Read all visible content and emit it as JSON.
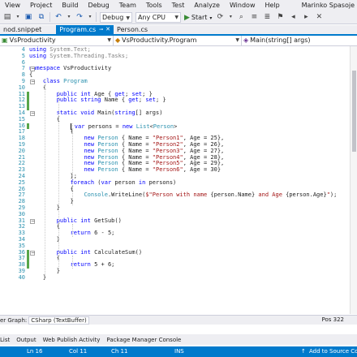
{
  "menubar": {
    "items": [
      "View",
      "Project",
      "Build",
      "Debug",
      "Team",
      "Tools",
      "Test",
      "Analyze",
      "Window",
      "Help"
    ],
    "user": "Marinko Spasoje"
  },
  "toolbar": {
    "configuration": "Debug",
    "platform": "Any CPU",
    "start_label": "Start"
  },
  "tabs": [
    {
      "label": "nod.snippet",
      "active": false
    },
    {
      "label": "Program.cs",
      "active": true
    },
    {
      "label": "Person.cs",
      "active": false
    }
  ],
  "navbar": {
    "project": "VsProductivity",
    "type": "VsProductivity.Program",
    "member": "Main(string[] args)"
  },
  "code_lines": [
    {
      "n": "4",
      "html": "<span class=\"k\">using</span> System.Text;",
      "dim": true
    },
    {
      "n": "5",
      "html": "<span class=\"k\">using</span> System.Threading.Tasks;",
      "dim": true
    },
    {
      "n": "6",
      "html": ""
    },
    {
      "n": "7",
      "html": "<span class=\"k\">namespace</span> VsProductivity"
    },
    {
      "n": "8",
      "html": "{"
    },
    {
      "n": "9",
      "html": "    <span class=\"k\">class</span> <span class=\"t\">Program</span>"
    },
    {
      "n": "10",
      "html": "    {"
    },
    {
      "n": "11",
      "html": "        <span class=\"k\">public</span> <span class=\"k\">int</span> Age { <span class=\"k\">get</span>; <span class=\"k\">set</span>; }"
    },
    {
      "n": "12",
      "html": "        <span class=\"k\">public</span> <span class=\"k\">string</span> Name { <span class=\"k\">get</span>; <span class=\"k\">set</span>; }"
    },
    {
      "n": "13",
      "html": ""
    },
    {
      "n": "14",
      "html": "        <span class=\"k\">static</span> <span class=\"k\">void</span> Main(<span class=\"k\">string</span>[] args)"
    },
    {
      "n": "15",
      "html": "        {"
    },
    {
      "n": "16",
      "html": "            <span class=\"caret\"></span> <span class=\"k\">var</span> persons = <span class=\"k\">new</span> <span class=\"t\">List</span>&lt;<span class=\"t\">Person</span>&gt;"
    },
    {
      "n": "17",
      "html": "            {"
    },
    {
      "n": "18",
      "html": "                <span class=\"k\">new</span> <span class=\"t\">Person</span> { Name = <span class=\"s\">\"Person1\"</span>, Age = 25},"
    },
    {
      "n": "19",
      "html": "                <span class=\"k\">new</span> <span class=\"t\">Person</span> { Name = <span class=\"s\">\"Person2\"</span>, Age = 26},"
    },
    {
      "n": "20",
      "html": "                <span class=\"k\">new</span> <span class=\"t\">Person</span> { Name = <span class=\"s\">\"Person3\"</span>, Age = 27},"
    },
    {
      "n": "21",
      "html": "                <span class=\"k\">new</span> <span class=\"t\">Person</span> { Name = <span class=\"s\">\"Person4\"</span>, Age = 28},"
    },
    {
      "n": "22",
      "html": "                <span class=\"k\">new</span> <span class=\"t\">Person</span> { Name = <span class=\"s\">\"Person5\"</span>, Age = 29},"
    },
    {
      "n": "23",
      "html": "                <span class=\"k\">new</span> <span class=\"t\">Person</span> { Name = <span class=\"s\">\"Person6\"</span>, Age = 30}"
    },
    {
      "n": "24",
      "html": "            };"
    },
    {
      "n": "25",
      "html": "            <span class=\"k\">foreach</span> (<span class=\"k\">var</span> person <span class=\"k\">in</span> persons)"
    },
    {
      "n": "26",
      "html": "            {"
    },
    {
      "n": "27",
      "html": "                <span class=\"t\">Console</span>.WriteLine(<span class=\"s\">$\"Person with name </span>{person.Name}<span class=\"s\"> and Age </span>{person.Age}<span class=\"s\">\"</span>);"
    },
    {
      "n": "28",
      "html": "            }"
    },
    {
      "n": "29",
      "html": "        }"
    },
    {
      "n": "30",
      "html": ""
    },
    {
      "n": "31",
      "html": "        <span class=\"k\">public</span> <span class=\"k\">int</span> GetSub()"
    },
    {
      "n": "32",
      "html": "        {"
    },
    {
      "n": "33",
      "html": "            <span class=\"k\">return</span> 6 - 5;"
    },
    {
      "n": "34",
      "html": "        }"
    },
    {
      "n": "35",
      "html": ""
    },
    {
      "n": "36",
      "html": "        <span class=\"k\">public</span> <span class=\"k\">int</span> CalculateSum()"
    },
    {
      "n": "37",
      "html": "        {"
    },
    {
      "n": "38",
      "html": "            <span class=\"k\">return</span> 5 + 6;"
    },
    {
      "n": "39",
      "html": "        }"
    },
    {
      "n": "40",
      "html": "    }"
    }
  ],
  "bottombar": {
    "left_label": "er Graph:",
    "buffer": "CSharp (TextBuffer)",
    "position": "Pos 322"
  },
  "toolwindows": [
    "List",
    "Output",
    "Web Publish Activity",
    "Package Manager Console"
  ],
  "status": {
    "line": "Ln 16",
    "col": "Col 11",
    "ch": "Ch 11",
    "mode": "INS",
    "source_control": "Add to Source Cont"
  },
  "colors": {
    "accent": "#007acc",
    "keyword": "#0000ff",
    "type": "#2b91af",
    "string": "#a31515",
    "change_mark": "#57a64a"
  }
}
